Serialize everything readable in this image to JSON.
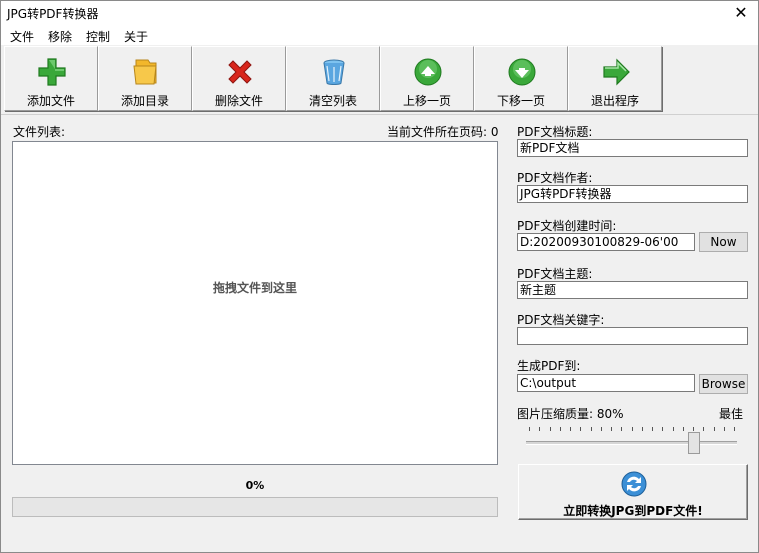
{
  "window": {
    "title": "JPG转PDF转换器",
    "close_symbol": "✕"
  },
  "menu": [
    "文件",
    "移除",
    "控制",
    "关于"
  ],
  "toolbar": [
    {
      "name": "add-file-button",
      "icon": "plus-icon",
      "label": "添加文件"
    },
    {
      "name": "add-folder-button",
      "icon": "folder-icon",
      "label": "添加目录"
    },
    {
      "name": "delete-file-button",
      "icon": "delete-x-icon",
      "label": "删除文件"
    },
    {
      "name": "clear-list-button",
      "icon": "trash-bin-icon",
      "label": "清空列表"
    },
    {
      "name": "move-up-button",
      "icon": "up-arrow-icon",
      "label": "上移一页"
    },
    {
      "name": "move-down-button",
      "icon": "down-arrow-icon",
      "label": "下移一页"
    },
    {
      "name": "exit-button",
      "icon": "right-arrow-icon",
      "label": "退出程序"
    }
  ],
  "file_list": {
    "label": "文件列表:",
    "page_label": "当前文件所在页码: 0",
    "placeholder": "拖拽文件到这里"
  },
  "progress": {
    "percent_text": "0%",
    "value": 0
  },
  "pdf": {
    "title_label": "PDF文档标题:",
    "title_value": "新PDF文档",
    "author_label": "PDF文档作者:",
    "author_value": "JPG转PDF转换器",
    "created_label": "PDF文档创建时间:",
    "created_value": "D:20200930100829-06'00",
    "now_button": "Now",
    "subject_label": "PDF文档主题:",
    "subject_value": "新主题",
    "keywords_label": "PDF文档关键字:",
    "keywords_value": "",
    "output_label": "生成PDF到:",
    "output_value": "C:\\output",
    "browse_button": "Browse",
    "quality_label": "图片压缩质量: 80%",
    "quality_best": "最佳",
    "quality_value": 80
  },
  "convert": {
    "label": "立即转换JPG到PDF文件!",
    "icon": "convert-refresh-icon"
  },
  "colors": {
    "green": "#3aa83a",
    "red": "#d8261c",
    "blue": "#3b8fd6",
    "yellow": "#f2b72b"
  }
}
